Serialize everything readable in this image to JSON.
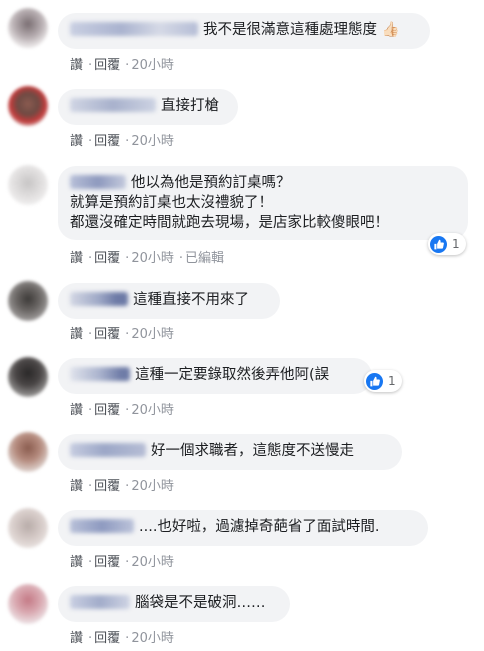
{
  "comments": [
    {
      "text_lines": [
        "我不是很滿意這種處理態度 👍🏻"
      ],
      "time": "20小時",
      "edited": "",
      "reactions": ""
    },
    {
      "text_lines": [
        "直接打槍"
      ],
      "time": "20小時",
      "edited": "",
      "reactions": ""
    },
    {
      "text_lines": [
        "他以為他是預約訂桌嗎？",
        "就算是預約訂桌也太沒禮貌了！",
        "都還沒確定時間就跑去現場，是店家比較傻眼吧！"
      ],
      "time": "20小時",
      "edited": "已編輯",
      "reactions": "1"
    },
    {
      "text_lines": [
        "這種直接不用來了"
      ],
      "time": "20小時",
      "edited": "",
      "reactions": ""
    },
    {
      "text_lines": [
        "這種一定要錄取然後弄他阿(誤"
      ],
      "time": "20小時",
      "edited": "",
      "reactions": "1"
    },
    {
      "text_lines": [
        "好一個求職者，這態度不送慢走"
      ],
      "time": "20小時",
      "edited": "",
      "reactions": ""
    },
    {
      "text_lines": [
        "....也好啦，過濾掉奇葩省了面試時間."
      ],
      "time": "20小時",
      "edited": "",
      "reactions": ""
    },
    {
      "text_lines": [
        "腦袋是不是破洞……"
      ],
      "time": "20小時",
      "edited": "",
      "reactions": ""
    }
  ],
  "action_labels": {
    "like": "讚",
    "reply": "回覆"
  },
  "icons": {
    "like_reaction": "thumbs-up-icon"
  },
  "colors": {
    "bubble_bg": "#f2f3f5",
    "meta_text": "#4b4f56",
    "like_blue": "#1877f2"
  }
}
